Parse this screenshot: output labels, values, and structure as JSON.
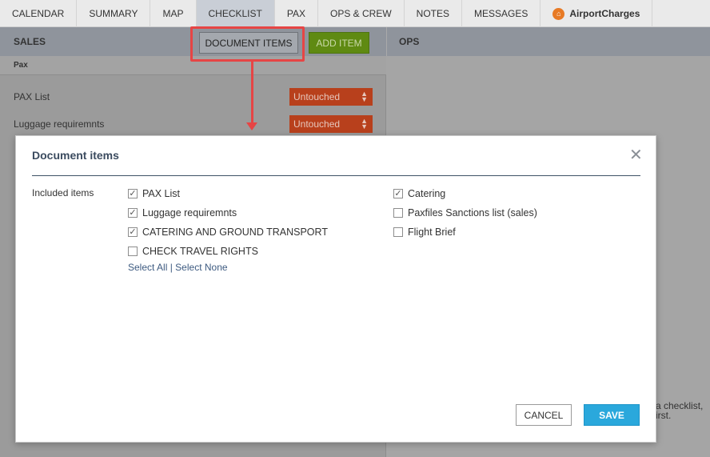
{
  "tabs": [
    {
      "label": "CALENDAR"
    },
    {
      "label": "SUMMARY"
    },
    {
      "label": "MAP"
    },
    {
      "label": "CHECKLIST",
      "active": true
    },
    {
      "label": "PAX"
    },
    {
      "label": "OPS & CREW"
    },
    {
      "label": "NOTES"
    },
    {
      "label": "MESSAGES"
    },
    {
      "label": "AirportCharges",
      "icon": "airportcharges-logo-icon"
    }
  ],
  "sales": {
    "title": "SALES",
    "document_items_label": "DOCUMENT ITEMS",
    "add_item_label": "ADD ITEM",
    "section": "Pax",
    "rows": [
      {
        "label": "PAX List",
        "status": "Untouched"
      },
      {
        "label": "Luggage requiremnts",
        "status": "Untouched"
      }
    ]
  },
  "ops": {
    "title": "OPS",
    "hint_line1": "a checklist,",
    "hint_line2": "irst."
  },
  "modal": {
    "title": "Document items",
    "included_label": "Included items",
    "left_items": [
      {
        "label": "PAX List",
        "checked": true
      },
      {
        "label": "Luggage requiremnts",
        "checked": true
      },
      {
        "label": "CATERING AND GROUND TRANSPORT",
        "checked": true
      },
      {
        "label": "CHECK TRAVEL RIGHTS",
        "checked": false
      }
    ],
    "right_items": [
      {
        "label": "Catering",
        "checked": true
      },
      {
        "label": "Paxfiles Sanctions list (sales)",
        "checked": false
      },
      {
        "label": "Flight Brief",
        "checked": false
      }
    ],
    "select_all": "Select All",
    "separator": "|",
    "select_none": "Select None",
    "cancel_label": "CANCEL",
    "save_label": "SAVE"
  },
  "colors": {
    "accent_save": "#2aa8dc",
    "status_untouched": "#b8401c",
    "add_item_green": "#5f8a12",
    "highlight_red": "#e64545"
  }
}
